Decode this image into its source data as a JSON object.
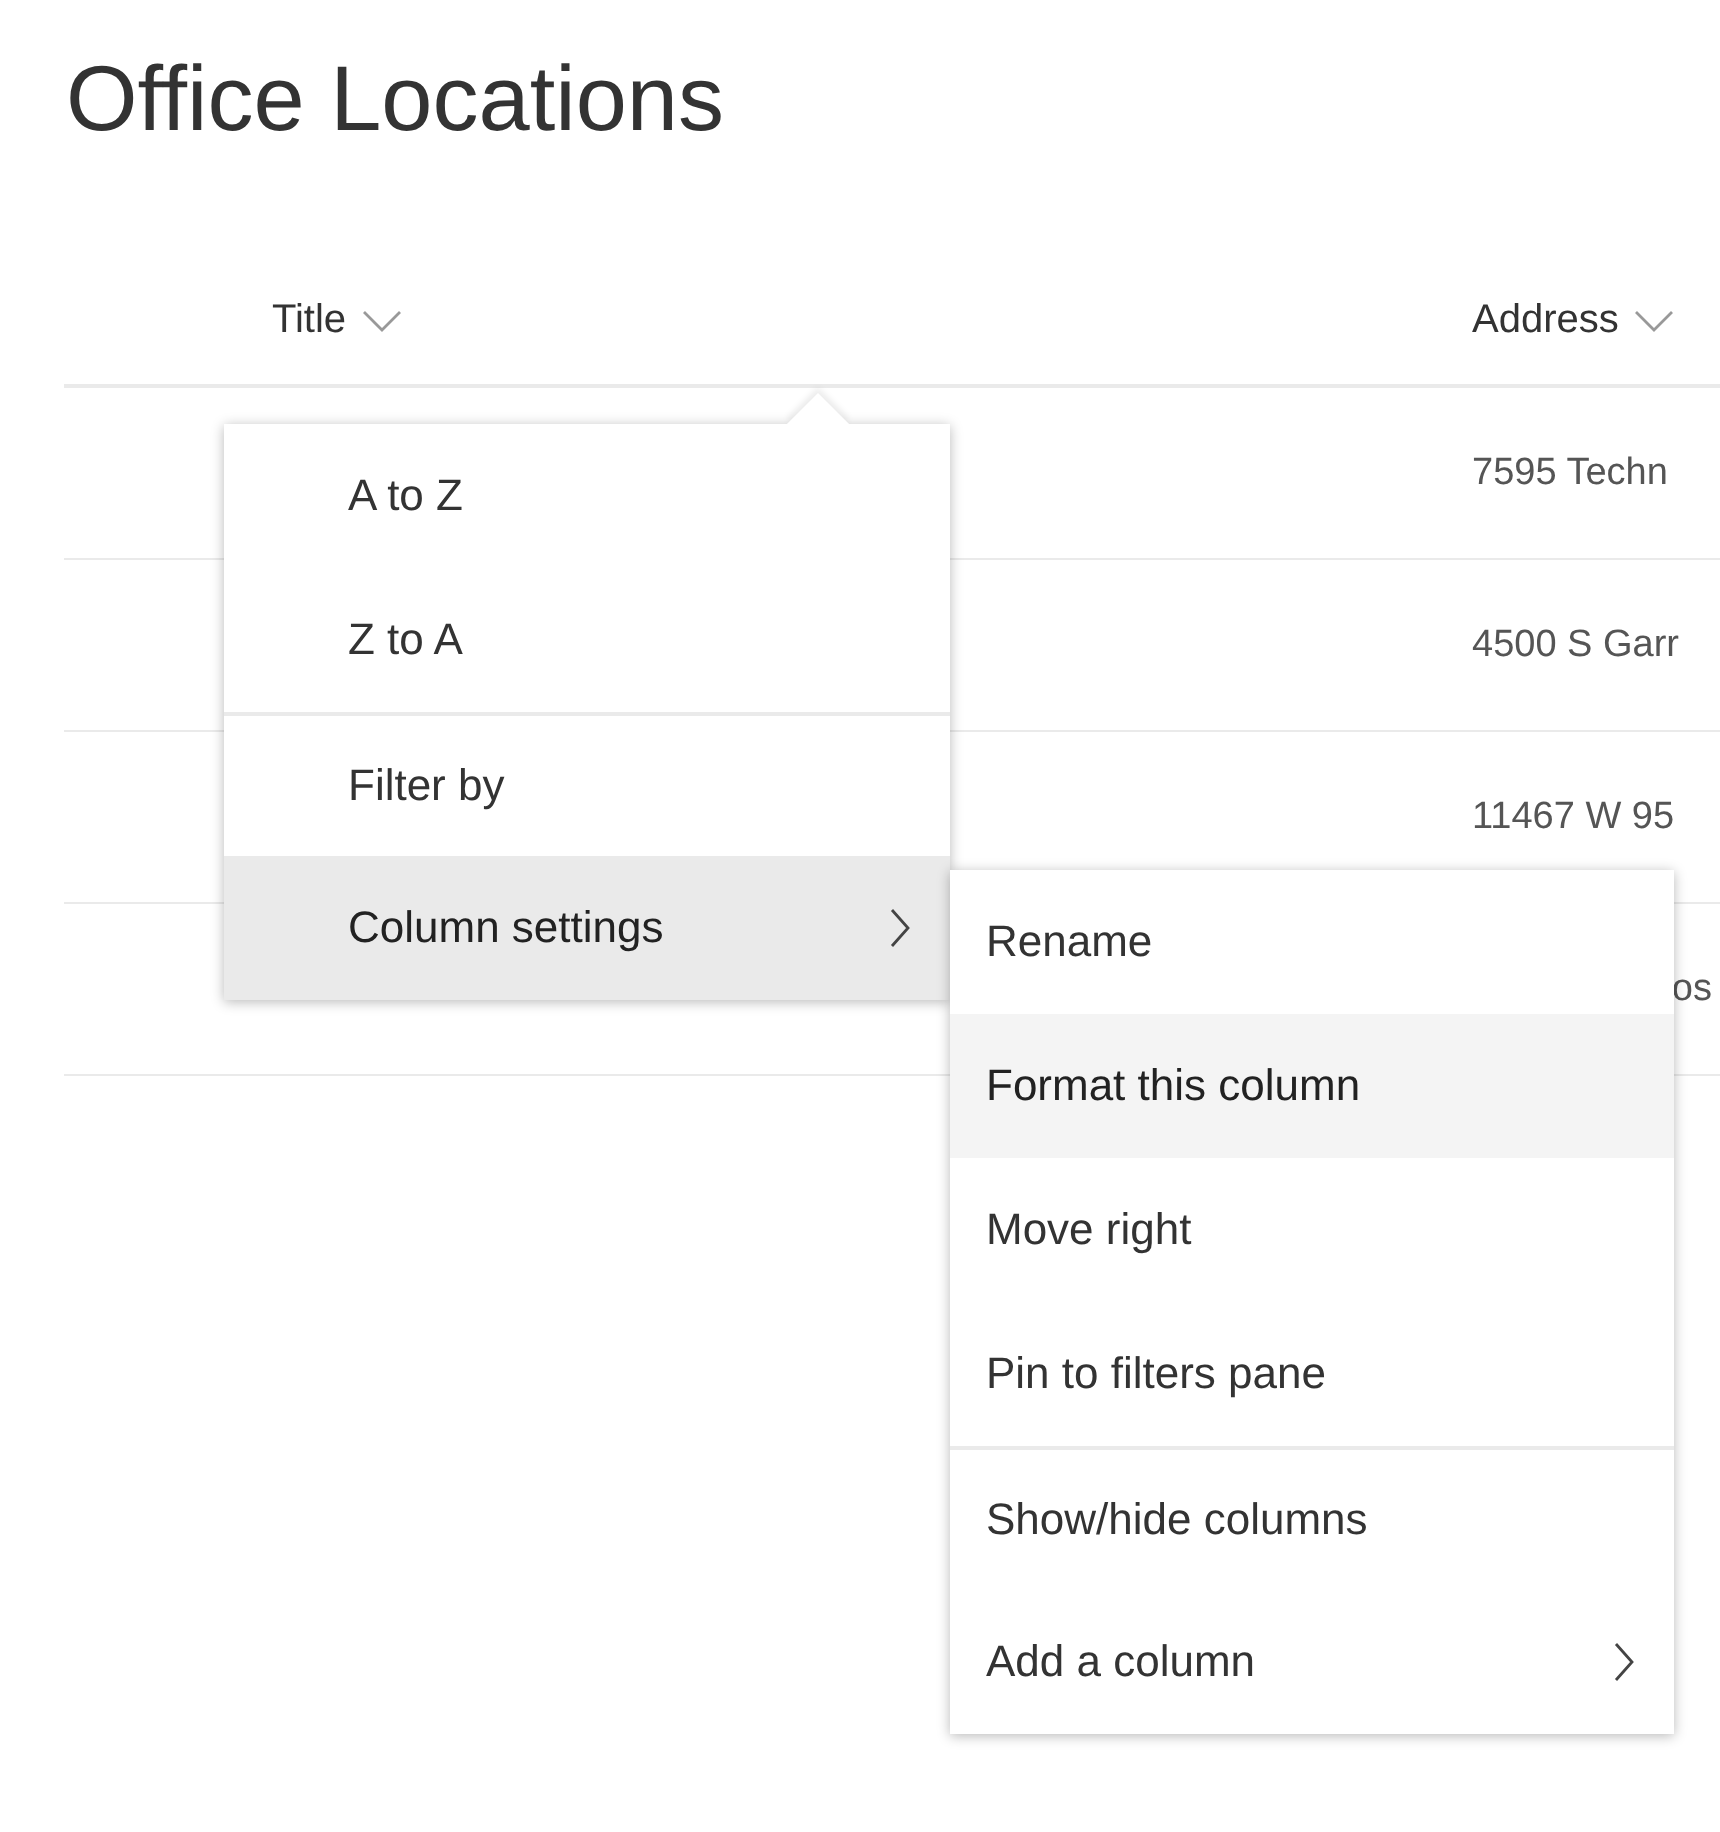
{
  "page": {
    "title": "Office Locations"
  },
  "table": {
    "columns": [
      {
        "label": "Title"
      },
      {
        "label": "Address"
      }
    ],
    "rows": [
      {
        "address": "7595 Techn"
      },
      {
        "address": "4500 S Garr"
      },
      {
        "address": "11467 W 95"
      },
      {
        "address": "os"
      }
    ]
  },
  "column_menu": {
    "items": [
      {
        "label": "A to Z",
        "highlighted": false,
        "has_submenu": false,
        "divider_before": false
      },
      {
        "label": "Z to A",
        "highlighted": false,
        "has_submenu": false,
        "divider_before": false
      },
      {
        "label": "Filter by",
        "highlighted": false,
        "has_submenu": false,
        "divider_before": true
      },
      {
        "label": "Column settings",
        "highlighted": true,
        "has_submenu": true,
        "divider_before": false
      }
    ]
  },
  "submenu": {
    "items": [
      {
        "label": "Rename",
        "highlighted": false,
        "has_submenu": false,
        "divider_before": false
      },
      {
        "label": "Format this column",
        "highlighted": true,
        "has_submenu": false,
        "divider_before": false
      },
      {
        "label": "Move right",
        "highlighted": false,
        "has_submenu": false,
        "divider_before": false
      },
      {
        "label": "Pin to filters pane",
        "highlighted": false,
        "has_submenu": false,
        "divider_before": false
      },
      {
        "label": "Show/hide columns",
        "highlighted": false,
        "has_submenu": false,
        "divider_before": true
      },
      {
        "label": "Add a column",
        "highlighted": false,
        "has_submenu": true,
        "divider_before": false
      }
    ]
  }
}
